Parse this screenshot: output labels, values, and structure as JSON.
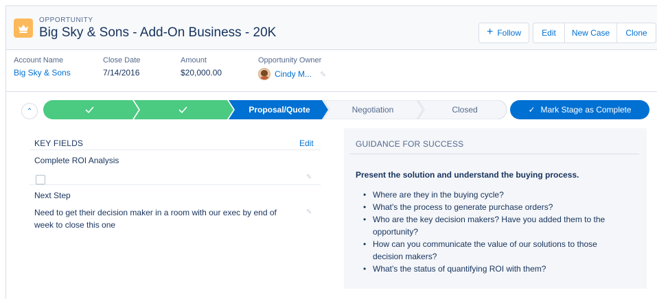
{
  "header": {
    "object_label": "OPPORTUNITY",
    "title": "Big Sky & Sons - Add-On Business - 20K",
    "icon": "crown-icon",
    "icon_color": "#fcb95b",
    "follow_label": "Follow",
    "actions": [
      "Edit",
      "New Case",
      "Clone"
    ]
  },
  "highlights": [
    {
      "label": "Account Name",
      "value": "Big Sky & Sons"
    },
    {
      "label": "Close Date",
      "value": "7/14/2016"
    },
    {
      "label": "Amount",
      "value": "$20,000.00"
    },
    {
      "label": "Opportunity Owner",
      "value": "Cindy M..."
    }
  ],
  "path": {
    "stages": [
      {
        "label": "",
        "status": "complete"
      },
      {
        "label": "",
        "status": "complete"
      },
      {
        "label": "Proposal/Quote",
        "status": "current"
      },
      {
        "label": "Negotiation",
        "status": "incomplete"
      },
      {
        "label": "Closed",
        "status": "incomplete"
      }
    ],
    "mark_complete_label": "Mark Stage as Complete",
    "colors": {
      "complete": "#4bca81",
      "current": "#0070d2",
      "incomplete": "#f4f6f9"
    }
  },
  "key_fields": {
    "title": "KEY FIELDS",
    "edit_label": "Edit",
    "fields": [
      {
        "label": "Complete ROI Analysis",
        "checked": false
      },
      {
        "label": "Next Step",
        "value": "Need to get their decision maker in a room with our exec by end of week to close this one"
      }
    ]
  },
  "guidance": {
    "title": "GUIDANCE FOR SUCCESS",
    "heading": "Present the solution and understand the buying process.",
    "items": [
      "Where are they in the buying cycle?",
      "What's the process to generate purchase orders?",
      "Who are the key decision makers? Have you added them to the opportunity?",
      "How can you communicate the value of our solutions to those decision makers?",
      "What's the status of quantifying ROI with them?"
    ]
  }
}
